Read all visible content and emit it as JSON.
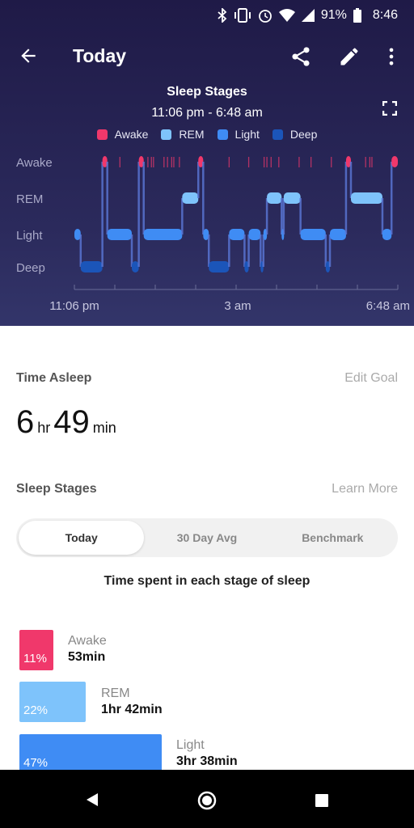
{
  "status_bar": {
    "battery": "91%",
    "time": "8:46",
    "icons": [
      "bluetooth-icon",
      "vibrate-icon",
      "alarm-icon",
      "wifi-icon",
      "signal-icon",
      "battery-icon"
    ]
  },
  "app_bar": {
    "title": "Today",
    "icons": [
      "back-arrow-icon",
      "share-icon",
      "edit-icon",
      "more-icon"
    ]
  },
  "chart_data": {
    "type": "hypnogram",
    "title": "Sleep Stages",
    "subtitle": "11:06 pm - 6:48 am",
    "legend": [
      {
        "name": "Awake",
        "color": "#f0386b"
      },
      {
        "name": "REM",
        "color": "#7ec3fb"
      },
      {
        "name": "Light",
        "color": "#3f8cf4"
      },
      {
        "name": "Deep",
        "color": "#1b55b9"
      }
    ],
    "y_levels": [
      "Awake",
      "REM",
      "Light",
      "Deep"
    ],
    "x_tick_labels": [
      "11:06 pm",
      "3 am",
      "6:48 am"
    ],
    "start": "23:06",
    "end": "06:48",
    "segments": [
      [
        "23:06",
        "Light"
      ],
      [
        "23:15",
        "Deep"
      ],
      [
        "23:46",
        "Awake"
      ],
      [
        "23:53",
        "Light"
      ],
      [
        "00:28",
        "Deep"
      ],
      [
        "00:38",
        "Awake"
      ],
      [
        "00:45",
        "Light"
      ],
      [
        "01:40",
        "REM"
      ],
      [
        "02:03",
        "Awake"
      ],
      [
        "02:10",
        "Light"
      ],
      [
        "02:18",
        "Deep"
      ],
      [
        "02:47",
        "Light"
      ],
      [
        "03:09",
        "Deep"
      ],
      [
        "03:15",
        "Light"
      ],
      [
        "03:32",
        "Deep"
      ],
      [
        "03:36",
        "Light"
      ],
      [
        "03:41",
        "REM"
      ],
      [
        "04:02",
        "Light"
      ],
      [
        "04:05",
        "REM"
      ],
      [
        "04:29",
        "Light"
      ],
      [
        "05:05",
        "Deep"
      ],
      [
        "05:11",
        "Light"
      ],
      [
        "05:34",
        "Awake"
      ],
      [
        "05:41",
        "REM"
      ],
      [
        "06:26",
        "Light"
      ],
      [
        "06:39",
        "Awake"
      ]
    ],
    "brief_awakenings": [
      "00:11",
      "00:51",
      "00:56",
      "00:59",
      "01:14",
      "01:19",
      "01:25",
      "01:28",
      "01:36",
      "02:47",
      "03:15",
      "03:37",
      "03:41",
      "03:47",
      "03:58",
      "04:27",
      "04:44",
      "05:13",
      "06:02",
      "06:08",
      "06:11"
    ]
  },
  "time_asleep": {
    "label": "Time Asleep",
    "link": "Edit Goal",
    "hours": "6",
    "hr_unit": "hr",
    "minutes": "49",
    "min_unit": "min"
  },
  "sleep_stages": {
    "label": "Sleep Stages",
    "link": "Learn More",
    "tabs": [
      {
        "label": "Today",
        "active": true
      },
      {
        "label": "30 Day Avg"
      },
      {
        "label": "Benchmark"
      }
    ],
    "caption": "Time spent in each stage of sleep",
    "stages": [
      {
        "name": "Awake",
        "percent": "11%",
        "duration": "53min",
        "color": "#f0386b"
      },
      {
        "name": "REM",
        "percent": "22%",
        "duration": "1hr 42min",
        "color": "#7ec3fb"
      },
      {
        "name": "Light",
        "percent": "47%",
        "duration": "3hr 38min",
        "color": "#3f8cf4"
      }
    ]
  }
}
